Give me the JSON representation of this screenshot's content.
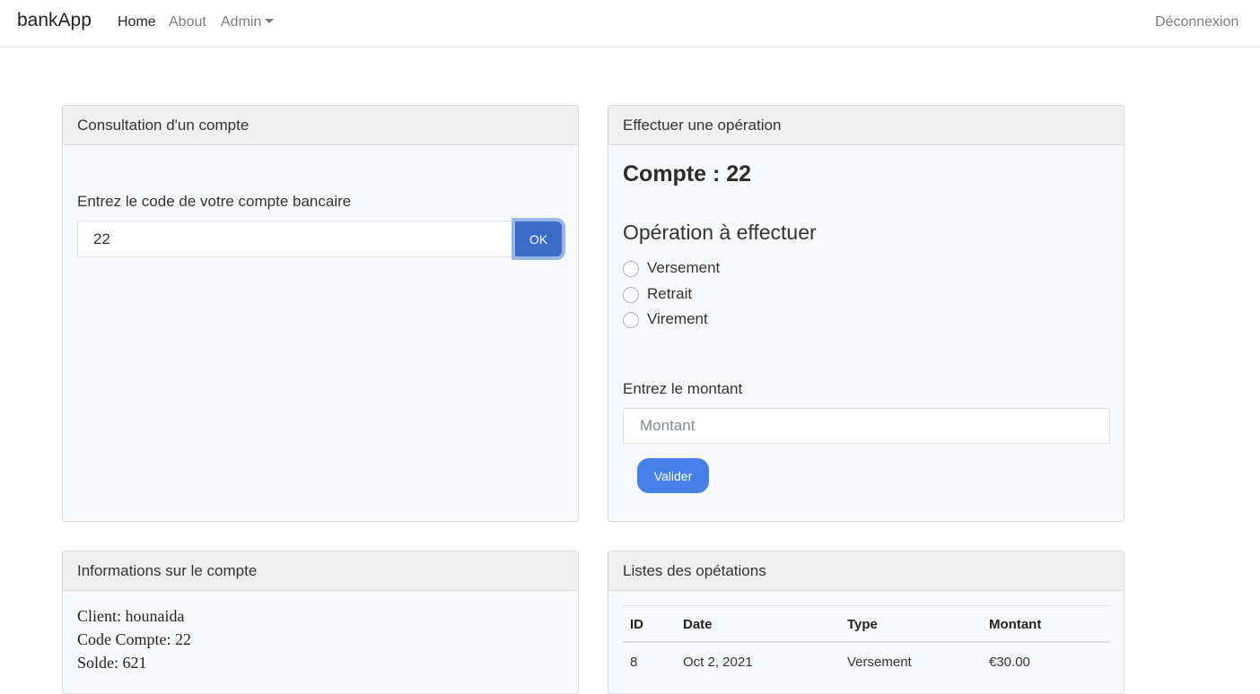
{
  "navbar": {
    "brand": "bankApp",
    "links": [
      "Home",
      "About",
      "Admin"
    ],
    "logout": "Déconnexion"
  },
  "consultation": {
    "title": "Consultation d'un compte",
    "label": "Entrez le code de votre compte bancaire",
    "code_value": "22",
    "ok_label": "OK"
  },
  "operation": {
    "title": "Effectuer une opération",
    "compte": "Compte : 22",
    "operation_title": "Opération à effectuer",
    "options": [
      "Versement",
      "Retrait",
      "Virement"
    ],
    "montant_label": "Entrez le montant",
    "montant_placeholder": "Montant",
    "submit_label": "Valider"
  },
  "info": {
    "title": "Informations sur le compte",
    "lines": [
      "Client: hounaida",
      "Code Compte: 22",
      "Solde: 621"
    ]
  },
  "operations_list": {
    "title": "Listes des opétations",
    "columns": [
      "ID",
      "Date",
      "Type",
      "Montant"
    ],
    "rows": [
      [
        "8",
        "Oct 2, 2021",
        "Versement",
        "€30.00"
      ]
    ]
  },
  "colors": {
    "primary": "#4580e6",
    "ok_button": "#3a6bc6"
  }
}
